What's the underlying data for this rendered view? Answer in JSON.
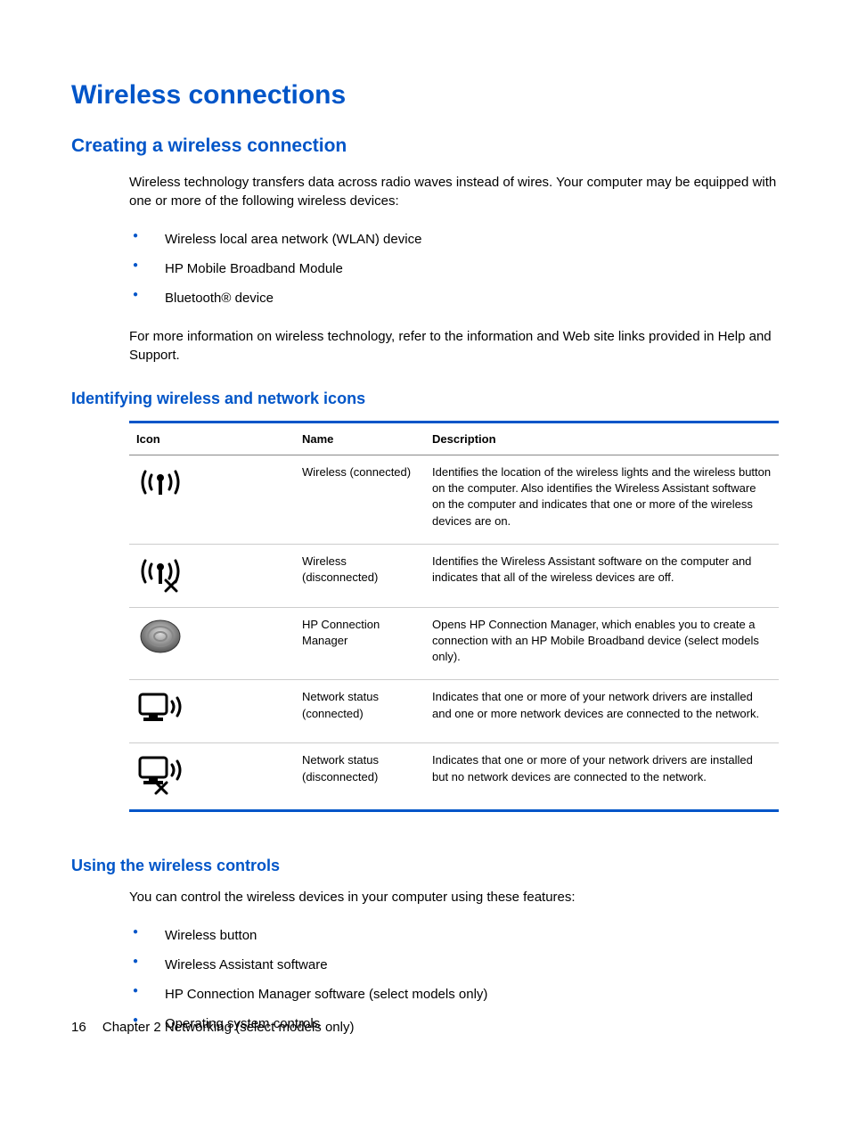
{
  "page_title": "Wireless connections",
  "section1": {
    "heading": "Creating a wireless connection",
    "intro": "Wireless technology transfers data across radio waves instead of wires. Your computer may be equipped with one or more of the following wireless devices:",
    "bullets": [
      "Wireless local area network (WLAN) device",
      "HP Mobile Broadband Module",
      "Bluetooth® device"
    ],
    "outro": "For more information on wireless technology, refer to the information and Web site links provided in Help and Support."
  },
  "section2": {
    "heading": "Identifying wireless and network icons",
    "table": {
      "headers": {
        "icon": "Icon",
        "name": "Name",
        "desc": "Description"
      },
      "rows": [
        {
          "icon": "wireless-connected-icon",
          "name": "Wireless (connected)",
          "desc": "Identifies the location of the wireless lights and the wireless button on the computer. Also identifies the Wireless Assistant software on the computer and indicates that one or more of the wireless devices are on."
        },
        {
          "icon": "wireless-disconnected-icon",
          "name": "Wireless (disconnected)",
          "desc": "Identifies the Wireless Assistant software on the computer and indicates that all of the wireless devices are off."
        },
        {
          "icon": "hp-connection-manager-icon",
          "name": "HP Connection Manager",
          "desc": "Opens HP Connection Manager, which enables you to create a connection with an HP Mobile Broadband device (select models only)."
        },
        {
          "icon": "network-connected-icon",
          "name": "Network status (connected)",
          "desc": "Indicates that one or more of your network drivers are installed and one or more network devices are connected to the network."
        },
        {
          "icon": "network-disconnected-icon",
          "name": "Network status (disconnected)",
          "desc": "Indicates that one or more of your network drivers are installed but no network devices are connected to the network."
        }
      ]
    }
  },
  "section3": {
    "heading": "Using the wireless controls",
    "intro": "You can control the wireless devices in your computer using these features:",
    "bullets": [
      "Wireless button",
      "Wireless Assistant software",
      "HP Connection Manager software (select models only)",
      "Operating system controls"
    ]
  },
  "footer": {
    "page_number": "16",
    "chapter": "Chapter 2   Networking (select models only)"
  }
}
